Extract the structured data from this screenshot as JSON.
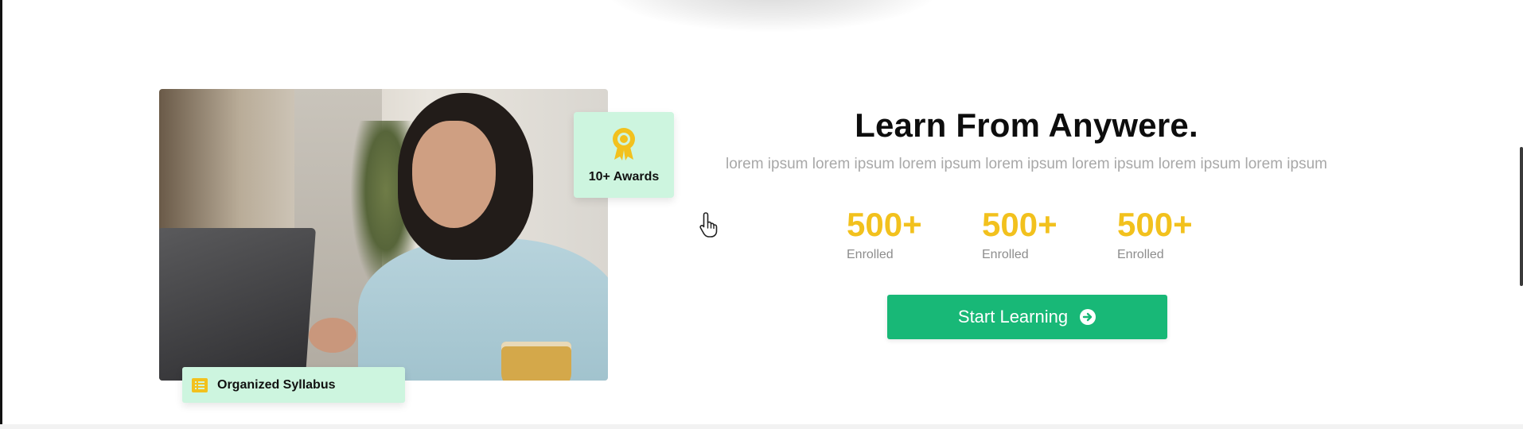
{
  "hero_image": {
    "alt": "Woman in light blue sweater working on a laptop"
  },
  "awards_badge": {
    "label": "10+ Awards",
    "icon": "award-ribbon-icon"
  },
  "syllabus_badge": {
    "label": "Organized Syllabus",
    "icon": "list-icon"
  },
  "content": {
    "headline": "Learn From Anywere.",
    "subtext": "lorem ipsum lorem ipsum lorem ipsum lorem ipsum lorem ipsum lorem ipsum lorem ipsum"
  },
  "stats": [
    {
      "value": "500+",
      "label": "Enrolled"
    },
    {
      "value": "500+",
      "label": "Enrolled"
    },
    {
      "value": "500+",
      "label": "Enrolled"
    }
  ],
  "cta": {
    "label": "Start Learning",
    "icon": "arrow-right-circle-icon"
  },
  "colors": {
    "accent_green": "#18b877",
    "badge_bg": "#cdf5df",
    "stat_yellow": "#f2c11d",
    "award_icon": "#f2c11d"
  }
}
